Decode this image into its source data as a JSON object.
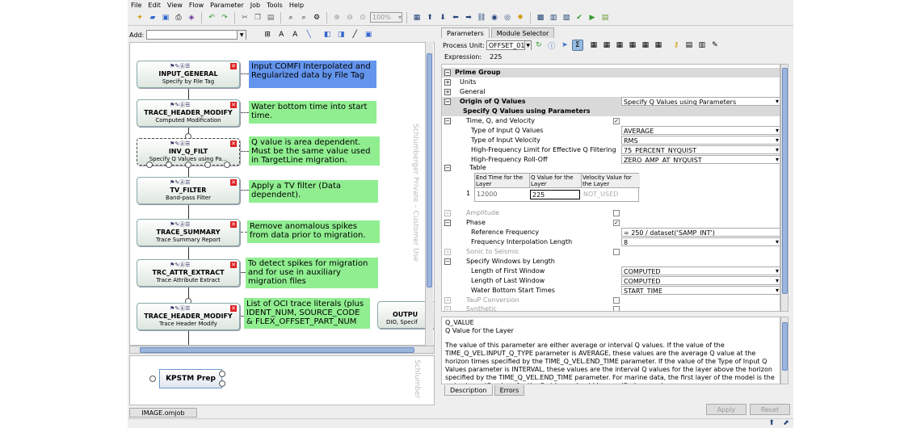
{
  "menu": [
    "File",
    "Edit",
    "View",
    "Flow",
    "Parameter",
    "Job",
    "Tools",
    "Help"
  ],
  "toolbar": {
    "zoom": "100%"
  },
  "left": {
    "add_label": "Add:",
    "watermark": "Schlumberger Private – Customer Use",
    "watermark_small": "Schlumber",
    "modules": [
      {
        "name": "INPUT_GENERAL",
        "sub": "Specify by File Tag"
      },
      {
        "name": "TRACE_HEADER_MODIFY",
        "sub": "Computed Modification"
      },
      {
        "name": "INV_Q_FILT",
        "sub": "Specify Q Values using Pa..."
      },
      {
        "name": "TV_FILTER",
        "sub": "Band-pass Filter"
      },
      {
        "name": "TRACE_SUMMARY",
        "sub": "Trace Summary Report"
      },
      {
        "name": "TRC_ATTR_EXTRACT",
        "sub": "Trace Attribute Extract"
      },
      {
        "name": "TRACE_HEADER_MODIFY",
        "sub": "Trace Header Modify"
      },
      {
        "name": "OUTPU",
        "sub": "DIO, Specif"
      }
    ],
    "notes": [
      "Input COMFI Interpolated and Regularized data by File Tag",
      "Water bottom time into start time.",
      "Q value is area dependent. Must be the same value used in TargetLine migration.",
      "Apply a TV filter (Data dependent).",
      "Remove anomalous spikes from data prior to migration.",
      "To detect spikes for migration and for use in auxiliary migration files",
      "List of OCI trace literals (plus IDENT_NUM, SOURCE_CODE & FLEX_OFFSET_PART_NUM"
    ],
    "mini_module": "KPSTM Prep",
    "file_tab": "IMAGE.omjob"
  },
  "right": {
    "tabs": [
      "Parameters",
      "Module Selector"
    ],
    "process_unit_label": "Process Unit:",
    "process_unit": "OFFSET_01",
    "expression_label": "Expression:",
    "expression_value": "225",
    "rows": {
      "prime_group": "Prime Group",
      "units": "Units",
      "general": "General",
      "origin": "Origin of Q Values",
      "origin_val": "Specify Q Values using Parameters",
      "specify_q": "Specify Q Values using Parameters",
      "tqv": "Time, Q, and Velocity",
      "type_q": "Type of Input Q Values",
      "type_q_val": "AVERAGE",
      "type_v": "Type of Input Velocity",
      "type_v_val": "RMS",
      "hf_limit": "High-Frequency Limit for Effective Q Filtering",
      "hf_limit_val": "75_PERCENT_NYQUIST",
      "hf_roll": "High-Frequency Roll-Off",
      "hf_roll_val": "ZERO_AMP_AT_NYQUIST",
      "table": "Table",
      "amplitude": "Amplitude",
      "phase": "Phase",
      "ref_freq": "Reference Frequency",
      "ref_freq_val": "= 250 / dataset('SAMP_INT')",
      "freq_interp": "Frequency Interpolation Length",
      "freq_interp_val": "8",
      "sonic": "Sonic to Seismic",
      "windows": "Specify Windows by Length",
      "len_first": "Length of First Window",
      "len_first_val": "COMPUTED",
      "len_last": "Length of Last Window",
      "len_last_val": "COMPUTED",
      "wb_start": "Water Bottom Start Times",
      "wb_start_val": "START_TIME",
      "taup": "TauP Conversion",
      "synthetic": "Synthetic"
    },
    "table": {
      "headers": [
        "End Time for the Layer",
        "Q Value for the Layer",
        "Velocity Value for the Layer"
      ],
      "row_index": "1",
      "cells": [
        "12000",
        "225",
        "NOT_USED"
      ]
    },
    "description": {
      "key": "Q_VALUE",
      "title": "Q Value for the Layer",
      "body": "The value of this parameter are either average or interval Q values. If the value of the TIME_Q_VEL.INPUT_Q_TYPE parameter is AVERAGE, these values are the average Q value at the horizon times specified by the TIME_Q_VEL.END_TIME parameter. If the value of the Type of Input Q Values parameter is INTERVAL, these values are the interval Q values for the layer above the horizon specified by the TIME_Q_VEL.END_TIME parameter. For marine data, the first layer of the model is the water layer (Q values for the first layer should be specified as zero)."
    },
    "desc_tabs": [
      "Description",
      "Errors"
    ],
    "apply": "Apply",
    "reset": "Reset"
  }
}
